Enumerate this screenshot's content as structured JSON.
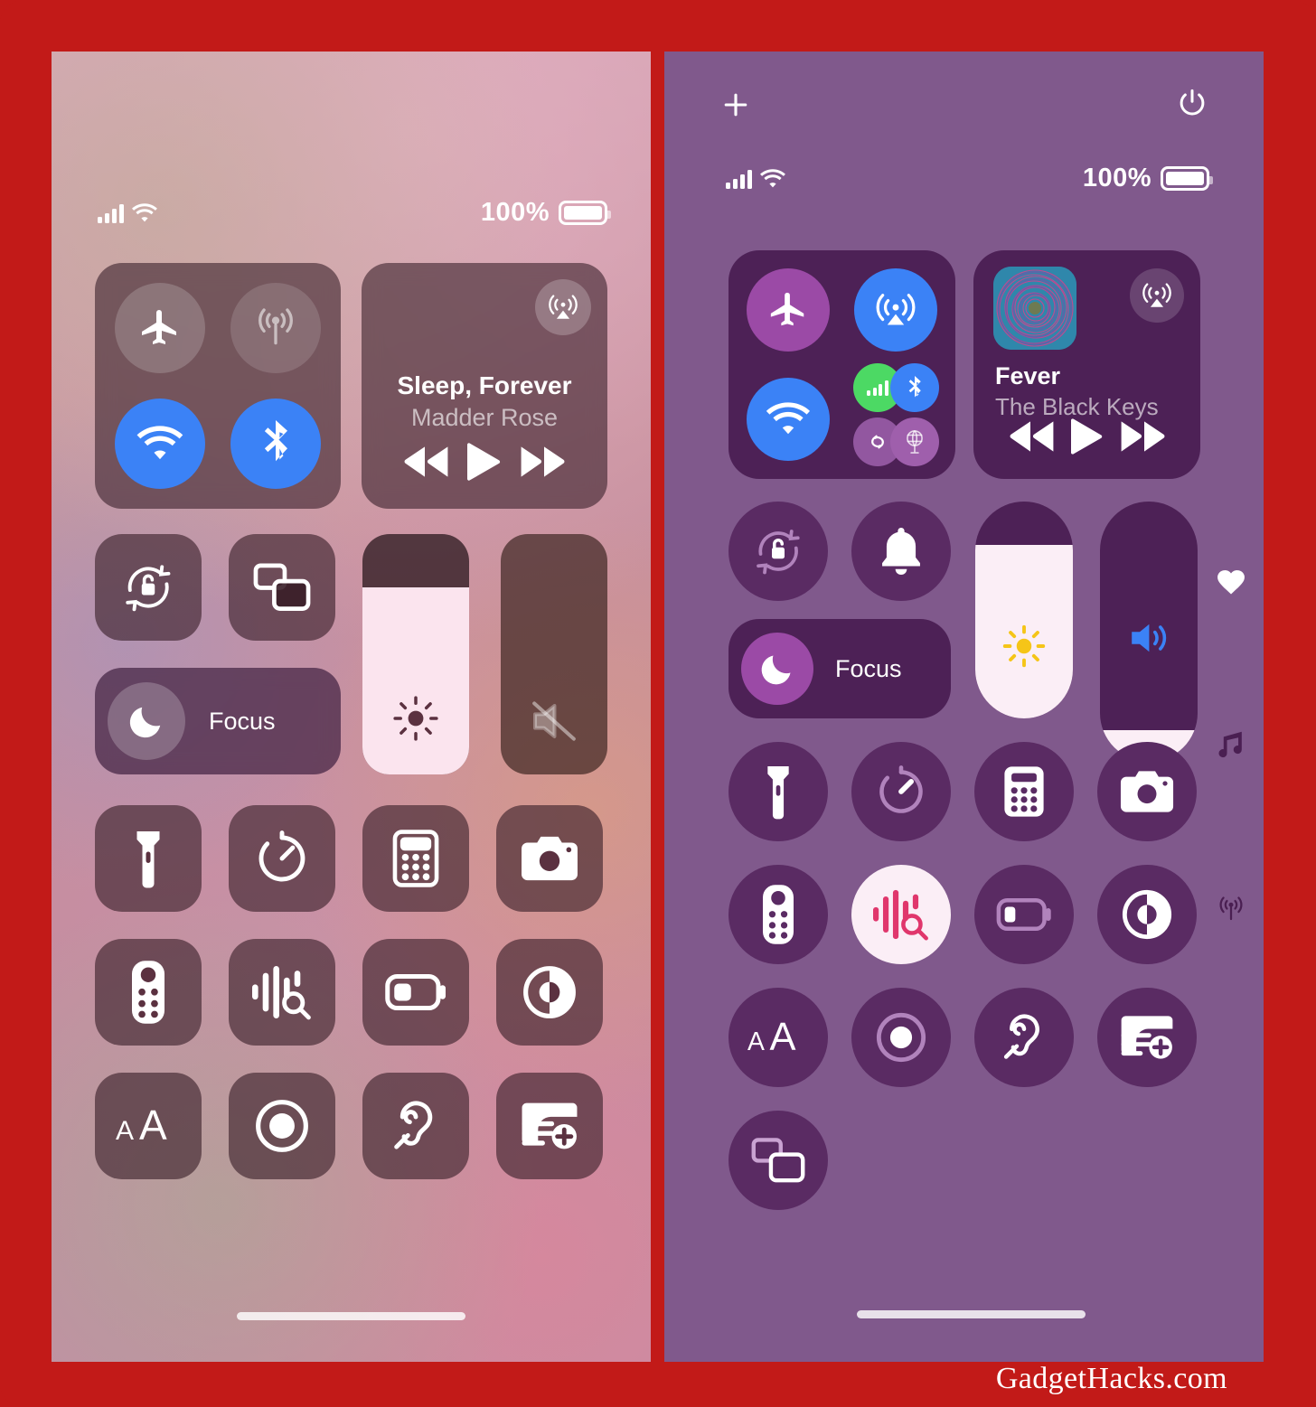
{
  "meta": {
    "watermark": "GadgetHacks.com",
    "frame_color": "#C21A18",
    "right_panel_bg": "#80598C",
    "right_module_bg": "#4D2156",
    "accent_blue": "#3B82F6",
    "accent_green": "#4CD964",
    "accent_yellow": "#F5C518",
    "slider_fill": "#FBEEF6"
  },
  "left_panel": {
    "name": "control-center-default",
    "status_bar": {
      "signal_icon": "cellular-bars-icon",
      "wifi_icon": "wifi-icon",
      "battery_percent": "100%",
      "battery_icon": "battery-full-icon"
    },
    "connectivity": {
      "airplane": {
        "label": "Airplane Mode",
        "icon": "airplane-icon",
        "state": "off"
      },
      "cellular": {
        "label": "Cellular Data",
        "icon": "cellular-antenna-icon",
        "state": "off"
      },
      "wifi": {
        "label": "Wi-Fi",
        "icon": "wifi-icon",
        "state": "on"
      },
      "bluetooth": {
        "label": "Bluetooth",
        "icon": "bluetooth-icon",
        "state": "on"
      }
    },
    "media": {
      "title": "Sleep, Forever",
      "artist": "Madder Rose",
      "airplay_icon": "airplay-audio-icon",
      "rewind_icon": "rewind-icon",
      "play_icon": "play-icon",
      "forward_icon": "fast-forward-icon"
    },
    "rotation_lock": {
      "label": "Rotation Lock",
      "icon": "rotation-lock-icon"
    },
    "screen_mirroring": {
      "label": "Screen Mirroring",
      "icon": "screen-mirroring-icon"
    },
    "focus": {
      "label": "Focus",
      "icon": "moon-icon"
    },
    "brightness": {
      "label": "Brightness",
      "icon": "brightness-sun-icon",
      "value": 78
    },
    "volume": {
      "label": "Volume",
      "icon": "speaker-mute-icon",
      "value": 0,
      "muted": true
    },
    "grid": [
      {
        "label": "Flashlight",
        "icon": "flashlight-icon"
      },
      {
        "label": "Timer",
        "icon": "timer-icon"
      },
      {
        "label": "Calculator",
        "icon": "calculator-icon"
      },
      {
        "label": "Camera",
        "icon": "camera-icon"
      },
      {
        "label": "Apple TV Remote",
        "icon": "tv-remote-icon"
      },
      {
        "label": "Music Recognition",
        "icon": "shazam-music-recognition-icon"
      },
      {
        "label": "Low Power Mode",
        "icon": "low-battery-icon"
      },
      {
        "label": "Dark Mode",
        "icon": "dark-mode-contrast-icon"
      },
      {
        "label": "Text Size",
        "icon": "text-size-icon"
      },
      {
        "label": "Screen Recording",
        "icon": "screen-record-icon"
      },
      {
        "label": "Hearing",
        "icon": "hearing-ear-icon"
      },
      {
        "label": "Quick Note",
        "icon": "quick-note-icon"
      }
    ],
    "home_indicator": "home-indicator"
  },
  "right_panel": {
    "name": "control-center-ios18-redesign",
    "top_bar": {
      "add_button": {
        "label": "Add a Control",
        "icon": "plus-icon"
      },
      "power_button": {
        "label": "Power Off",
        "icon": "power-icon"
      }
    },
    "status_bar": {
      "signal_icon": "cellular-bars-icon",
      "wifi_icon": "wifi-icon",
      "battery_percent": "100%",
      "battery_icon": "battery-full-icon"
    },
    "connectivity": {
      "airplane": {
        "label": "Airplane Mode",
        "icon": "airplane-icon",
        "state": "off"
      },
      "airdrop": {
        "label": "AirDrop",
        "icon": "airdrop-icon",
        "state": "on"
      },
      "wifi": {
        "label": "Wi-Fi",
        "icon": "wifi-icon",
        "state": "on"
      },
      "cellular": {
        "label": "Cellular Data",
        "icon": "cellular-bars-icon",
        "state": "on"
      },
      "bluetooth": {
        "label": "Bluetooth",
        "icon": "bluetooth-icon",
        "state": "on"
      },
      "hotspot": {
        "label": "Personal Hotspot",
        "icon": "hotspot-link-icon",
        "state": "off"
      },
      "vpn": {
        "label": "VPN",
        "icon": "vpn-globe-icon",
        "state": "off"
      }
    },
    "media": {
      "title": "Fever",
      "artist": "The Black Keys",
      "artwork": "album-artwork-spiral",
      "airplay_icon": "airplay-audio-icon",
      "rewind_icon": "rewind-icon",
      "play_icon": "play-icon",
      "forward_icon": "fast-forward-icon"
    },
    "rotation_lock": {
      "label": "Rotation Lock",
      "icon": "rotation-lock-icon"
    },
    "ring_bell": {
      "label": "Ringer",
      "icon": "bell-icon"
    },
    "focus": {
      "label": "Focus",
      "icon": "moon-icon"
    },
    "brightness": {
      "label": "Brightness",
      "icon": "brightness-sun-icon",
      "value": 80
    },
    "volume": {
      "label": "Volume",
      "icon": "speaker-volume-icon",
      "value": 12
    },
    "page_dots": [
      {
        "label": "Favorites page",
        "icon": "heart-icon",
        "active": true
      },
      {
        "label": "Media page",
        "icon": "music-note-icon",
        "active": false
      },
      {
        "label": "Connectivity page",
        "icon": "broadcast-icon",
        "active": false
      }
    ],
    "grid": [
      {
        "label": "Flashlight",
        "icon": "flashlight-icon",
        "highlight": false
      },
      {
        "label": "Timer",
        "icon": "timer-icon",
        "highlight": false
      },
      {
        "label": "Calculator",
        "icon": "calculator-icon",
        "highlight": false
      },
      {
        "label": "Camera",
        "icon": "camera-icon",
        "highlight": false
      },
      {
        "label": "Apple TV Remote",
        "icon": "tv-remote-icon",
        "highlight": false
      },
      {
        "label": "Music Recognition",
        "icon": "shazam-music-recognition-icon",
        "highlight": true
      },
      {
        "label": "Low Power Mode",
        "icon": "low-battery-icon",
        "highlight": false
      },
      {
        "label": "Dark Mode",
        "icon": "dark-mode-contrast-icon",
        "highlight": false
      },
      {
        "label": "Text Size",
        "icon": "text-size-icon",
        "highlight": false
      },
      {
        "label": "Screen Recording",
        "icon": "screen-record-icon",
        "highlight": false
      },
      {
        "label": "Hearing",
        "icon": "hearing-ear-icon",
        "highlight": false
      },
      {
        "label": "Quick Note",
        "icon": "quick-note-icon",
        "highlight": false
      },
      {
        "label": "Screen Mirroring",
        "icon": "screen-mirroring-icon",
        "highlight": false
      }
    ],
    "home_indicator": "home-indicator"
  }
}
